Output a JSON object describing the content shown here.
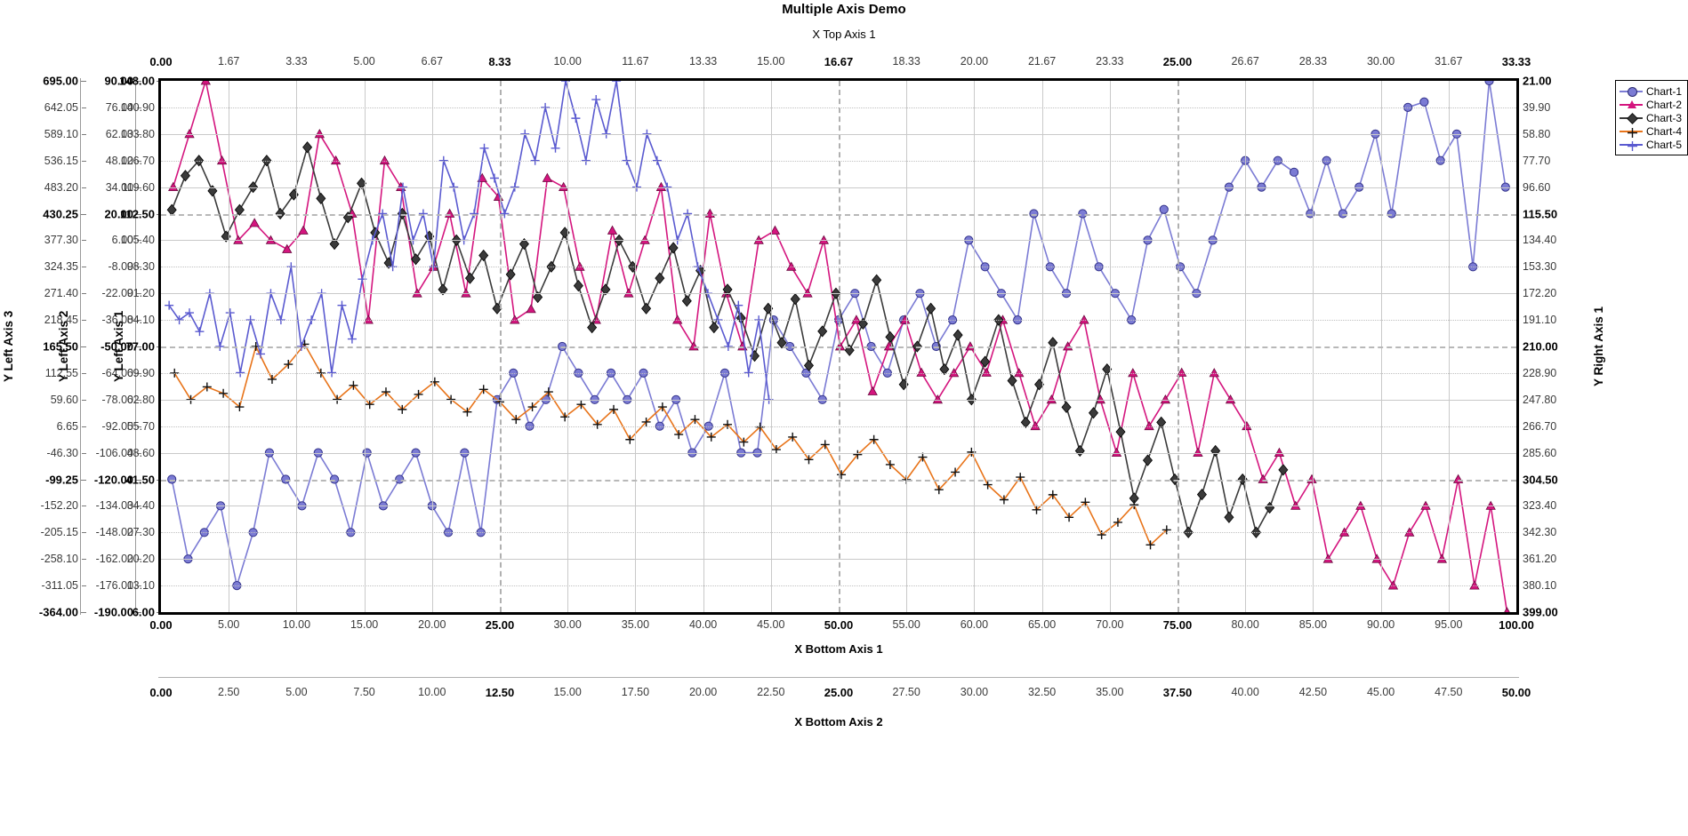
{
  "title": "Multiple Axis Demo",
  "axes": {
    "x_top_1": {
      "title": "X Top Axis 1",
      "min": 0.0,
      "max": 33.33,
      "ticks": [
        "0.00",
        "1.67",
        "3.33",
        "5.00",
        "6.67",
        "8.33",
        "10.00",
        "11.67",
        "13.33",
        "15.00",
        "16.67",
        "18.33",
        "20.00",
        "21.67",
        "23.33",
        "25.00",
        "26.67",
        "28.33",
        "30.00",
        "31.67",
        "33.33"
      ],
      "bold_ticks": [
        "0.00",
        "8.33",
        "16.67",
        "25.00",
        "33.33"
      ]
    },
    "x_bottom_1": {
      "title": "X Bottom Axis 1",
      "min": 0.0,
      "max": 100.0,
      "ticks": [
        "0.00",
        "5.00",
        "10.00",
        "15.00",
        "20.00",
        "25.00",
        "30.00",
        "35.00",
        "40.00",
        "45.00",
        "50.00",
        "55.00",
        "60.00",
        "65.00",
        "70.00",
        "75.00",
        "80.00",
        "85.00",
        "90.00",
        "95.00",
        "100.00"
      ],
      "bold_ticks": [
        "0.00",
        "25.00",
        "50.00",
        "75.00",
        "100.00"
      ]
    },
    "x_bottom_2": {
      "title": "X Bottom Axis 2",
      "min": 0.0,
      "max": 50.0,
      "ticks": [
        "0.00",
        "2.50",
        "5.00",
        "7.50",
        "10.00",
        "12.50",
        "15.00",
        "17.50",
        "20.00",
        "22.50",
        "25.00",
        "27.50",
        "30.00",
        "32.50",
        "35.00",
        "37.50",
        "40.00",
        "42.50",
        "45.00",
        "47.50",
        "50.00"
      ],
      "bold_ticks": [
        "0.00",
        "12.50",
        "25.00",
        "37.50",
        "50.00"
      ]
    },
    "y_left_1": {
      "title": "Y Left Axis 1",
      "min": 6.0,
      "max": 148.0,
      "inverted": false,
      "ticks": [
        "148.00",
        "140.90",
        "133.80",
        "126.70",
        "119.60",
        "112.50",
        "105.40",
        "98.30",
        "91.20",
        "84.10",
        "77.00",
        "69.90",
        "62.80",
        "55.70",
        "48.60",
        "41.50",
        "34.40",
        "27.30",
        "20.20",
        "13.10",
        "6.00"
      ],
      "bold_ticks": [
        "148.00",
        "112.50",
        "77.00",
        "41.50",
        "6.00"
      ]
    },
    "y_left_2": {
      "title": "Y Left Axis 2",
      "min": -190.0,
      "max": 90.0,
      "inverted": false,
      "ticks": [
        "90.00",
        "76.00",
        "62.00",
        "48.00",
        "34.00",
        "20.00",
        "6.00",
        "-8.00",
        "-22.00",
        "-36.00",
        "-50.00",
        "-64.00",
        "-78.00",
        "-92.00",
        "-106.00",
        "-120.00",
        "-134.00",
        "-148.00",
        "-162.00",
        "-176.00",
        "-190.00"
      ],
      "bold_ticks": [
        "90.00",
        "20.00",
        "-50.00",
        "-120.00",
        "-190.00"
      ]
    },
    "y_left_3": {
      "title": "Y Left Axis 3",
      "min": -364.0,
      "max": 695.0,
      "inverted": false,
      "ticks": [
        "695.00",
        "642.05",
        "589.10",
        "536.15",
        "483.20",
        "430.25",
        "377.30",
        "324.35",
        "271.40",
        "218.45",
        "165.50",
        "112.55",
        "59.60",
        "6.65",
        "-46.30",
        "-99.25",
        "-152.20",
        "-205.15",
        "-258.10",
        "-311.05",
        "-364.00"
      ],
      "bold_ticks": [
        "695.00",
        "430.25",
        "165.50",
        "-99.25",
        "-364.00"
      ]
    },
    "y_right_1": {
      "title": "Y Right Axis 1",
      "min": 21.0,
      "max": 399.0,
      "inverted": true,
      "ticks": [
        "21.00",
        "39.90",
        "58.80",
        "77.70",
        "96.60",
        "115.50",
        "134.40",
        "153.30",
        "172.20",
        "191.10",
        "210.00",
        "228.90",
        "247.80",
        "266.70",
        "285.60",
        "304.50",
        "323.40",
        "342.30",
        "361.20",
        "380.10",
        "399.00"
      ],
      "bold_ticks": [
        "21.00",
        "115.50",
        "210.00",
        "304.50",
        "399.00"
      ]
    }
  },
  "legend": {
    "position": "right",
    "entries": [
      {
        "label": "Chart-1",
        "color": "#7b7bd4",
        "marker": "circle"
      },
      {
        "label": "Chart-2",
        "color": "#d4157e",
        "marker": "triangle"
      },
      {
        "label": "Chart-3",
        "color": "#3a3a3a",
        "marker": "diamond"
      },
      {
        "label": "Chart-4",
        "color": "#e8741a",
        "marker": "plus"
      },
      {
        "label": "Chart-5",
        "color": "#5a5ad0",
        "marker": "plus"
      }
    ]
  },
  "chart_data": {
    "type": "line",
    "title": "Multiple Axis Demo",
    "xlabel": "X Bottom Axis 1",
    "ylabel": "Y Left Axis 1",
    "grid": true,
    "legend_position": "right",
    "series": [
      {
        "name": "Chart-1",
        "color": "#7b7bd4",
        "marker": "circle",
        "x_axis": "x_bottom_1",
        "y_axis": "y_right_1",
        "xlim": [
          0,
          100
        ],
        "ylim": [
          21,
          399
        ],
        "x": [
          0.8,
          2.0,
          3.2,
          4.4,
          5.6,
          6.8,
          8.0,
          9.2,
          10.4,
          11.6,
          12.8,
          14.0,
          15.2,
          16.4,
          17.6,
          18.8,
          20.0,
          21.2,
          22.4,
          23.6,
          24.8,
          26.0,
          27.2,
          28.4,
          29.6,
          30.8,
          32.0,
          33.2,
          34.4,
          35.6,
          36.8,
          38.0,
          39.2,
          40.4,
          41.6,
          42.8,
          44.0,
          45.2,
          46.4,
          47.6,
          48.8,
          50.0,
          51.2,
          52.4,
          53.6,
          54.8,
          56.0,
          57.2,
          58.4,
          59.6,
          60.8,
          62.0,
          63.2,
          64.4,
          65.6,
          66.8,
          68.0,
          69.2,
          70.4,
          71.6,
          72.8,
          74.0,
          75.2,
          76.4,
          77.6,
          78.8,
          80.0,
          81.2,
          82.4,
          83.6,
          84.8,
          86.0,
          87.2,
          88.4,
          89.6,
          90.8,
          92.0,
          93.2,
          94.4,
          95.6,
          96.8,
          98.0,
          99.2
        ],
        "y": [
          304.5,
          361.2,
          342.3,
          323.4,
          380.1,
          342.3,
          285.6,
          304.5,
          323.4,
          285.6,
          304.5,
          342.3,
          285.6,
          323.4,
          304.5,
          285.6,
          323.4,
          342.3,
          285.6,
          342.3,
          247.8,
          228.9,
          266.7,
          247.8,
          210.0,
          228.9,
          247.8,
          228.9,
          247.8,
          228.9,
          266.7,
          247.8,
          285.6,
          266.7,
          228.9,
          285.6,
          285.6,
          191.1,
          210.0,
          228.9,
          247.8,
          191.1,
          172.2,
          210.0,
          228.9,
          191.1,
          172.2,
          210.0,
          191.1,
          134.4,
          153.3,
          172.2,
          191.1,
          115.5,
          153.3,
          172.2,
          115.5,
          153.3,
          172.2,
          191.1,
          134.4,
          112.5,
          153.3,
          172.2,
          134.4,
          96.6,
          77.7,
          96.6,
          77.7,
          86.0,
          115.5,
          77.7,
          115.5,
          96.6,
          58.8,
          115.5,
          39.9,
          36.0,
          77.7,
          58.8,
          153.3,
          21.0,
          96.6
        ]
      },
      {
        "name": "Chart-2",
        "color": "#d4157e",
        "marker": "triangle",
        "x_axis": "x_top_1",
        "y_axis": "y_left_1",
        "xlim": [
          0,
          33.33
        ],
        "ylim": [
          6,
          148
        ],
        "x": [
          0.3,
          0.7,
          1.1,
          1.5,
          1.9,
          2.3,
          2.7,
          3.1,
          3.5,
          3.9,
          4.3,
          4.7,
          5.1,
          5.5,
          5.9,
          6.3,
          6.7,
          7.1,
          7.5,
          7.9,
          8.3,
          8.7,
          9.1,
          9.5,
          9.9,
          10.3,
          10.7,
          11.1,
          11.5,
          11.9,
          12.3,
          12.7,
          13.1,
          13.5,
          13.9,
          14.3,
          14.7,
          15.1,
          15.5,
          15.9,
          16.3,
          16.7,
          17.1,
          17.5,
          17.9,
          18.3,
          18.7,
          19.1,
          19.5,
          19.9,
          20.3,
          20.7,
          21.1,
          21.5,
          21.9,
          22.3,
          22.7,
          23.1,
          23.5,
          23.9,
          24.3,
          24.7,
          25.1,
          25.5,
          25.9,
          26.3,
          26.7,
          27.1,
          27.5,
          27.9,
          28.3,
          28.7,
          29.1,
          29.5,
          29.9,
          30.3,
          30.7,
          31.1,
          31.5,
          31.9,
          32.3,
          32.7,
          33.1
        ],
        "y": [
          119.6,
          133.8,
          148.0,
          126.7,
          105.4,
          110.0,
          105.4,
          103.0,
          108.0,
          133.8,
          126.7,
          112.5,
          84.1,
          126.7,
          119.6,
          91.2,
          98.3,
          112.5,
          91.2,
          122.0,
          117.0,
          84.1,
          87.0,
          122.0,
          119.6,
          98.3,
          84.1,
          108.0,
          91.2,
          105.4,
          119.6,
          84.1,
          77.0,
          112.5,
          91.2,
          77.0,
          105.4,
          108.0,
          98.3,
          91.2,
          105.4,
          77.0,
          84.1,
          65.0,
          77.0,
          84.1,
          70.0,
          62.8,
          69.9,
          77.0,
          70.0,
          84.1,
          69.9,
          55.7,
          62.8,
          77.0,
          84.1,
          62.8,
          48.6,
          69.9,
          55.7,
          62.8,
          70.0,
          48.6,
          69.9,
          62.8,
          55.7,
          41.5,
          48.6,
          34.4,
          41.5,
          20.2,
          27.3,
          34.4,
          20.2,
          13.1,
          27.3,
          34.4,
          20.2,
          41.5,
          13.1,
          34.4,
          6.0
        ]
      },
      {
        "name": "Chart-3",
        "color": "#3a3a3a",
        "marker": "diamond",
        "x_axis": "x_bottom_2",
        "y_axis": "y_left_2",
        "xlim": [
          0,
          50
        ],
        "ylim": [
          -190,
          90
        ],
        "x": [
          0.4,
          0.9,
          1.4,
          1.9,
          2.4,
          2.9,
          3.4,
          3.9,
          4.4,
          4.9,
          5.4,
          5.9,
          6.4,
          6.9,
          7.4,
          7.9,
          8.4,
          8.9,
          9.4,
          9.9,
          10.4,
          10.9,
          11.4,
          11.9,
          12.4,
          12.9,
          13.4,
          13.9,
          14.4,
          14.9,
          15.4,
          15.9,
          16.4,
          16.9,
          17.4,
          17.9,
          18.4,
          18.9,
          19.4,
          19.9,
          20.4,
          20.9,
          21.4,
          21.9,
          22.4,
          22.9,
          23.4,
          23.9,
          24.4,
          24.9,
          25.4,
          25.9,
          26.4,
          26.9,
          27.4,
          27.9,
          28.4,
          28.9,
          29.4,
          29.9,
          30.4,
          30.9,
          31.4,
          31.9,
          32.4,
          32.9,
          33.4,
          33.9,
          34.4,
          34.9,
          35.4,
          35.9,
          36.4,
          36.9,
          37.4,
          37.9,
          38.4,
          38.9,
          39.4,
          39.9,
          40.4,
          40.9,
          41.4
        ],
        "y": [
          22.0,
          40.0,
          48.0,
          32.0,
          8.0,
          22.0,
          34.0,
          48.0,
          20.0,
          30.0,
          55.0,
          28.0,
          4.0,
          18.0,
          36.0,
          10.0,
          -6.0,
          20.0,
          -4.0,
          8.0,
          -20.0,
          6.0,
          -14.0,
          -2.0,
          -30.0,
          -12.0,
          4.0,
          -24.0,
          -8.0,
          10.0,
          -18.0,
          -40.0,
          -20.0,
          6.0,
          -8.0,
          -30.0,
          -14.0,
          2.0,
          -26.0,
          -10.0,
          -40.0,
          -20.0,
          -35.0,
          -55.0,
          -30.0,
          -48.0,
          -25.0,
          -60.0,
          -42.0,
          -22.0,
          -52.0,
          -38.0,
          -15.0,
          -45.0,
          -70.0,
          -50.0,
          -30.0,
          -62.0,
          -44.0,
          -78.0,
          -58.0,
          -36.0,
          -68.0,
          -90.0,
          -70.0,
          -48.0,
          -82.0,
          -105.0,
          -85.0,
          -62.0,
          -95.0,
          -130.0,
          -110.0,
          -90.0,
          -120.0,
          -148.0,
          -128.0,
          -105.0,
          -140.0,
          -120.0,
          -148.0,
          -135.0,
          -115.0
        ]
      },
      {
        "name": "Chart-4",
        "color": "#e8741a",
        "marker": "plus",
        "x_axis": "x_bottom_1",
        "y_axis": "y_left_3",
        "xlim": [
          0,
          100
        ],
        "ylim": [
          -364,
          695
        ],
        "x": [
          1.0,
          2.2,
          3.4,
          4.6,
          5.8,
          7.0,
          8.2,
          9.4,
          10.6,
          11.8,
          13.0,
          14.2,
          15.4,
          16.6,
          17.8,
          19.0,
          20.2,
          21.4,
          22.6,
          23.8,
          25.0,
          26.2,
          27.4,
          28.6,
          29.8,
          31.0,
          32.2,
          33.4,
          34.6,
          35.8,
          37.0,
          38.2,
          39.4,
          40.6,
          41.8,
          43.0,
          44.2,
          45.4,
          46.6,
          47.8,
          49.0,
          50.2,
          51.4,
          52.6,
          53.8,
          55.0,
          56.2,
          57.4,
          58.6,
          59.8,
          61.0,
          62.2,
          63.4,
          64.6,
          65.8,
          67.0,
          68.2,
          69.4,
          70.6,
          71.8,
          73.0,
          74.2
        ],
        "y": [
          112.55,
          59.6,
          85.0,
          72.0,
          45.0,
          165.5,
          100.0,
          130.0,
          170.0,
          112.55,
          60.0,
          88.0,
          50.0,
          75.0,
          40.0,
          70.0,
          95.0,
          60.0,
          35.0,
          80.0,
          55.0,
          20.0,
          45.0,
          75.0,
          25.0,
          50.0,
          10.0,
          40.0,
          -20.0,
          15.0,
          45.0,
          -10.0,
          20.0,
          -15.0,
          10.0,
          -25.0,
          5.0,
          -40.0,
          -15.0,
          -60.0,
          -30.0,
          -90.0,
          -50.0,
          -20.0,
          -70.0,
          -100.0,
          -55.0,
          -120.0,
          -85.0,
          -45.0,
          -110.0,
          -140.0,
          -95.0,
          -160.0,
          -130.0,
          -175.0,
          -145.0,
          -210.0,
          -185.0,
          -150.0,
          -230.0,
          -200.0
        ]
      },
      {
        "name": "Chart-5",
        "color": "#5a5ad0",
        "marker": "plus",
        "x_axis": "x_top_1",
        "y_axis": "y_left_1",
        "xlim": [
          0,
          33.33
        ],
        "ylim": [
          6,
          148
        ],
        "x": [
          0.2,
          0.45,
          0.7,
          0.95,
          1.2,
          1.45,
          1.7,
          1.95,
          2.2,
          2.45,
          2.7,
          2.95,
          3.2,
          3.45,
          3.7,
          3.95,
          4.2,
          4.45,
          4.7,
          4.95,
          5.2,
          5.45,
          5.7,
          5.95,
          6.2,
          6.45,
          6.7,
          6.95,
          7.2,
          7.45,
          7.7,
          7.95,
          8.2,
          8.45,
          8.7,
          8.95,
          9.2,
          9.45,
          9.7,
          9.95,
          10.2,
          10.45,
          10.7,
          10.95,
          11.2,
          11.45,
          11.7,
          11.95,
          12.2,
          12.45,
          12.7,
          12.95,
          13.2,
          13.45,
          13.7,
          13.95,
          14.2,
          14.45,
          14.7,
          14.95
        ],
        "y": [
          88.0,
          84.1,
          86.0,
          81.0,
          91.2,
          77.0,
          86.0,
          70.0,
          84.1,
          75.0,
          91.2,
          84.1,
          98.3,
          77.0,
          84.1,
          91.2,
          70.0,
          88.0,
          79.0,
          95.0,
          105.4,
          112.5,
          98.3,
          119.6,
          105.4,
          112.5,
          98.3,
          126.7,
          119.6,
          105.4,
          112.5,
          130.0,
          122.0,
          112.5,
          119.6,
          133.8,
          126.7,
          140.9,
          130.0,
          148.0,
          138.0,
          126.7,
          143.0,
          133.8,
          148.0,
          126.7,
          119.6,
          133.8,
          126.7,
          119.6,
          105.4,
          112.5,
          98.3,
          91.2,
          84.1,
          77.0,
          88.0,
          70.0,
          84.1,
          62.8
        ]
      }
    ]
  }
}
